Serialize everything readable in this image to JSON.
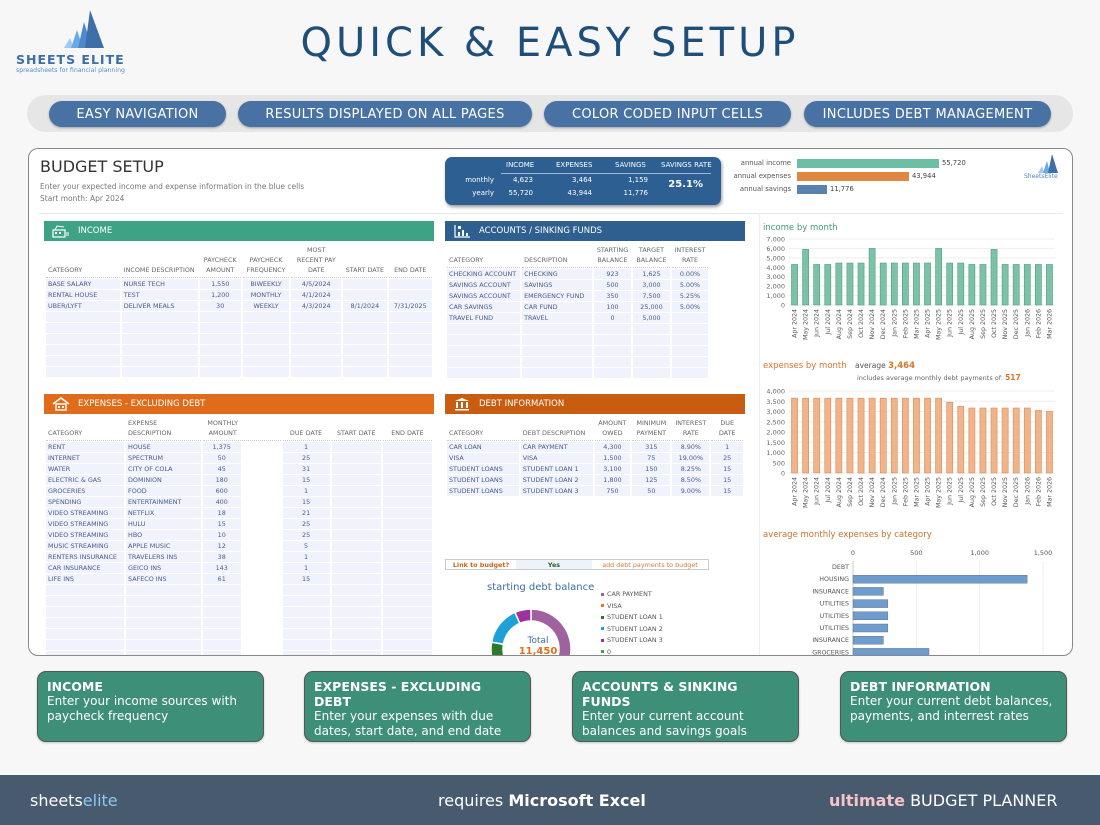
{
  "brand": {
    "name": "SHEETS ELITE",
    "tagline": "spreadsheets for financial planning"
  },
  "title": "QUICK & EASY SETUP",
  "features": [
    "EASY NAVIGATION",
    "RESULTS DISPLAYED ON ALL PAGES",
    "COLOR CODED INPUT CELLS",
    "INCLUDES DEBT MANAGEMENT"
  ],
  "sheet": {
    "title": "BUDGET SETUP",
    "subtitle": "Enter your expected income and expense information in the blue cells",
    "start_month_label": "Start month:",
    "start_month": "Apr 2024",
    "mini_logo": "SheetsElite",
    "summary": {
      "headers": [
        "INCOME",
        "EXPENSES",
        "SAVINGS",
        "SAVINGS RATE"
      ],
      "rows": [
        {
          "label": "monthly",
          "income": "4,623",
          "expenses": "3,464",
          "savings": "1,159"
        },
        {
          "label": "yearly",
          "income": "55,720",
          "expenses": "43,944",
          "savings": "11,776"
        }
      ],
      "savings_rate": "25.1%"
    },
    "annual": [
      {
        "label": "annual income",
        "value": 55720,
        "display": "55,720",
        "color": "#6cbfa4"
      },
      {
        "label": "annual expenses",
        "value": 43944,
        "display": "43,944",
        "color": "#de8844"
      },
      {
        "label": "annual savings",
        "value": 11776,
        "display": "11,776",
        "color": "#5a82ae"
      }
    ],
    "income": {
      "title": "INCOME",
      "headers": [
        "CATEGORY",
        "INCOME DESCRIPTION",
        "PAYCHECK AMOUNT",
        "PAYCHECK FREQUENCY",
        "MOST RECENT PAY DATE",
        "START DATE",
        "END DATE"
      ],
      "rows": [
        [
          "BASE SALARY",
          "NURSE TECH",
          "1,550",
          "BIWEEKLY",
          "4/5/2024",
          "",
          ""
        ],
        [
          "RENTAL HOUSE",
          "TEST",
          "1,200",
          "MONTHLY",
          "4/1/2024",
          "",
          ""
        ],
        [
          "UBER/LYFT",
          "DELIVER MEALS",
          "30",
          "WEEKLY",
          "4/3/2024",
          "8/1/2024",
          "7/31/2025"
        ]
      ]
    },
    "accounts": {
      "title": "ACCOUNTS / SINKING FUNDS",
      "headers": [
        "CATEGORY",
        "DESCRIPTION",
        "STARTING BALANCE",
        "TARGET BALANCE",
        "INTEREST RATE"
      ],
      "rows": [
        [
          "CHECKING ACCOUNT",
          "CHECKING",
          "923",
          "1,625",
          "0.00%"
        ],
        [
          "SAVINGS ACCOUNT",
          "SAVINGS",
          "500",
          "3,000",
          "5.00%"
        ],
        [
          "SAVINGS ACCOUNT",
          "EMERGENCY FUND",
          "350",
          "7,500",
          "5.25%"
        ],
        [
          "CAR SAVINGS",
          "CAR FUND",
          "100",
          "25,000",
          "5.00%"
        ],
        [
          "TRAVEL FUND",
          "TRAVEL",
          "0",
          "5,000",
          ""
        ]
      ]
    },
    "expenses": {
      "title": "EXPENSES - EXCLUDING DEBT",
      "headers": [
        "CATEGORY",
        "EXPENSE DESCRIPTION",
        "MONTHLY AMOUNT",
        "DUE DATE",
        "START DATE",
        "END DATE"
      ],
      "rows": [
        [
          "RENT",
          "HOUSE",
          "1,375",
          "1",
          "",
          ""
        ],
        [
          "INTERNET",
          "SPECTRUM",
          "50",
          "25",
          "",
          ""
        ],
        [
          "WATER",
          "CITY OF COLA",
          "45",
          "31",
          "",
          ""
        ],
        [
          "ELECTRIC & GAS",
          "DOMINION",
          "180",
          "15",
          "",
          ""
        ],
        [
          "GROCERIES",
          "FOOD",
          "600",
          "1",
          "",
          ""
        ],
        [
          "SPENDING",
          "ENTERTAINMENT",
          "400",
          "15",
          "",
          ""
        ],
        [
          "VIDEO STREAMING",
          "NETFLIX",
          "18",
          "21",
          "",
          ""
        ],
        [
          "VIDEO STREAMING",
          "HULU",
          "15",
          "25",
          "",
          ""
        ],
        [
          "VIDEO STREAMING",
          "HBO",
          "10",
          "25",
          "",
          ""
        ],
        [
          "MUSIC STREAMING",
          "APPLE MUSIC",
          "12",
          "5",
          "",
          ""
        ],
        [
          "RENTERS INSURANCE",
          "TRAVELERS INS",
          "38",
          "1",
          "",
          ""
        ],
        [
          "CAR INSURANCE",
          "GEICO INS",
          "143",
          "1",
          "",
          ""
        ],
        [
          "LIFE INS",
          "SAFECO INS",
          "61",
          "15",
          "",
          ""
        ]
      ]
    },
    "debt": {
      "title": "DEBT INFORMATION",
      "headers": [
        "CATEGORY",
        "DEBT DESCRIPTION",
        "AMOUNT OWED",
        "MINIMUM PAYMENT",
        "INTEREST RATE",
        "DUE DATE"
      ],
      "rows": [
        [
          "CAR LOAN",
          "CAR PAYMENT",
          "4,300",
          "315",
          "8.90%",
          "1"
        ],
        [
          "VISA",
          "VISA",
          "1,500",
          "75",
          "19.00%",
          "25"
        ],
        [
          "STUDENT LOANS",
          "STUDENT LOAN 1",
          "3,100",
          "150",
          "8.25%",
          "15"
        ],
        [
          "STUDENT LOANS",
          "STUDENT LOAN 2",
          "1,800",
          "125",
          "8.50%",
          "15"
        ],
        [
          "STUDENT LOANS",
          "STUDENT LOAN 3",
          "750",
          "50",
          "9.00%",
          "15"
        ]
      ],
      "link_label": "Link to budget?",
      "link_value": "Yes",
      "link_note": "add debt payments to budget"
    }
  },
  "chart_data": [
    {
      "type": "bar",
      "title": "income by month",
      "categories": [
        "Apr 2024",
        "May 2024",
        "Jun 2024",
        "Jul 2024",
        "Aug 2024",
        "Sep 2024",
        "Oct 2024",
        "Nov 2024",
        "Dec 2024",
        "Jan 2025",
        "Feb 2025",
        "Mar 2025",
        "Apr 2025",
        "May 2025",
        "Jun 2025",
        "Jul 2025",
        "Aug 2025",
        "Sep 2025",
        "Oct 2025",
        "Nov 2025",
        "Dec 2025",
        "Jan 2026",
        "Feb 2026",
        "Mar 2026"
      ],
      "values": [
        4300,
        5900,
        4300,
        4300,
        4450,
        4450,
        4450,
        6000,
        4450,
        4450,
        4450,
        4450,
        4450,
        6000,
        4450,
        4450,
        4300,
        4300,
        5900,
        4300,
        4300,
        4300,
        4300,
        4300
      ],
      "ylim": [
        0,
        7000
      ],
      "yticks": [
        "0",
        "1,000",
        "2,000",
        "3,000",
        "4,000",
        "5,000",
        "6,000",
        "7,000"
      ],
      "color": "#7cc2a8"
    },
    {
      "type": "bar",
      "title": "expenses by month",
      "average_label": "average",
      "average": "3,464",
      "note": "includes average monthly debt payments of:",
      "note_value": "517",
      "categories": [
        "Apr 2024",
        "May 2024",
        "Jun 2024",
        "Jul 2024",
        "Aug 2024",
        "Sep 2024",
        "Oct 2024",
        "Nov 2024",
        "Dec 2024",
        "Jan 2025",
        "Feb 2025",
        "Mar 2025",
        "Apr 2025",
        "May 2025",
        "Jun 2025",
        "Jul 2025",
        "Aug 2025",
        "Sep 2025",
        "Oct 2025",
        "Nov 2025",
        "Dec 2025",
        "Jan 2026",
        "Feb 2026",
        "Mar 2026"
      ],
      "values": [
        3650,
        3650,
        3650,
        3650,
        3650,
        3650,
        3650,
        3650,
        3650,
        3650,
        3650,
        3650,
        3650,
        3650,
        3450,
        3250,
        3170,
        3170,
        3170,
        3170,
        3170,
        3170,
        3050,
        3000
      ],
      "ylim": [
        0,
        4000
      ],
      "yticks": [
        "0",
        "500",
        "1,000",
        "1,500",
        "2,000",
        "2,500",
        "3,000",
        "3,500",
        "4,000"
      ],
      "color": "#f0b48a"
    },
    {
      "type": "bar",
      "orientation": "horizontal",
      "title": "average monthly expenses by category",
      "categories": [
        "DEBT",
        "HOUSING",
        "INSURANCE",
        "UTILITIES",
        "UTILITIES",
        "UTILITIES",
        "INSURANCE",
        "GROCERIES"
      ],
      "values": [
        0,
        1375,
        240,
        275,
        275,
        275,
        240,
        600
      ],
      "xlim": [
        0,
        1500
      ],
      "xticks": [
        "0",
        "500",
        "1,000",
        "1,500"
      ],
      "color": "#6d9ccf"
    },
    {
      "type": "pie",
      "title": "starting debt balance",
      "center_label": "Total",
      "center_value": "11,450",
      "labels": [
        "CAR PAYMENT",
        "VISA",
        "STUDENT LOAN 1",
        "STUDENT LOAN 2",
        "STUDENT LOAN 3",
        "0"
      ],
      "values": [
        4300,
        1500,
        3100,
        1800,
        750,
        0
      ],
      "colors": [
        "#a0629e",
        "#e8742c",
        "#2c7a2c",
        "#1ea0d8",
        "#a0309c",
        "#3fa63f"
      ]
    }
  ],
  "cards": [
    {
      "title": "INCOME",
      "desc": "Enter your income sources with paycheck frequency"
    },
    {
      "title": "EXPENSES - EXCLUDING DEBT",
      "desc": "Enter your expenses with due dates, start date, and end date"
    },
    {
      "title": "ACCOUNTS & SINKING FUNDS",
      "desc": "Enter your current account balances and savings goals"
    },
    {
      "title": "DEBT INFORMATION",
      "desc": "Enter your current debt balances, payments, and interrest rates"
    }
  ],
  "footer": {
    "brand_a": "sheets",
    "brand_b": "elite",
    "req_a": "requires ",
    "req_b": "Microsoft Excel",
    "prod_a": "ultimate",
    "prod_b": " BUDGET PLANNER"
  }
}
